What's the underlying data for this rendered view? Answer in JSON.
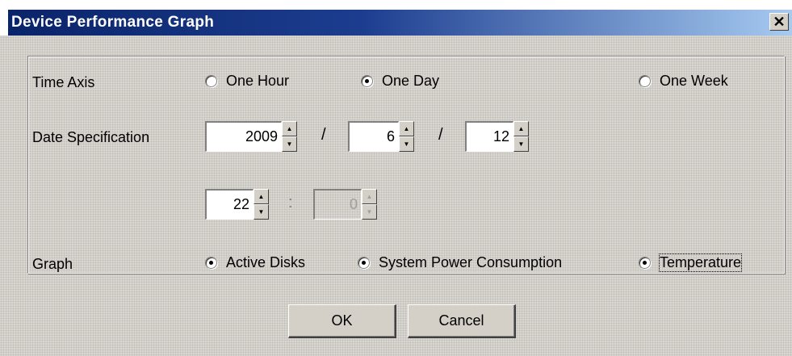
{
  "window": {
    "title": "Device Performance Graph",
    "close_glyph": "✕"
  },
  "time_axis": {
    "label": "Time Axis",
    "options": [
      {
        "label": "One Hour",
        "checked": false
      },
      {
        "label": "One Day",
        "checked": true
      },
      {
        "label": "One Week",
        "checked": false
      }
    ]
  },
  "date_spec": {
    "label": "Date Specification",
    "year": "2009",
    "month": "6",
    "day": "12",
    "date_sep": "/",
    "hour": "22",
    "minute": "0",
    "time_sep": ":",
    "minute_disabled": true,
    "up_glyph": "▲",
    "down_glyph": "▼"
  },
  "graph": {
    "label": "Graph",
    "options": [
      {
        "label": "Active Disks",
        "checked": true
      },
      {
        "label": "System Power Consumption",
        "checked": true
      },
      {
        "label": "Temperature",
        "checked": true,
        "focused": true
      }
    ]
  },
  "buttons": {
    "ok": "OK",
    "cancel": "Cancel"
  }
}
